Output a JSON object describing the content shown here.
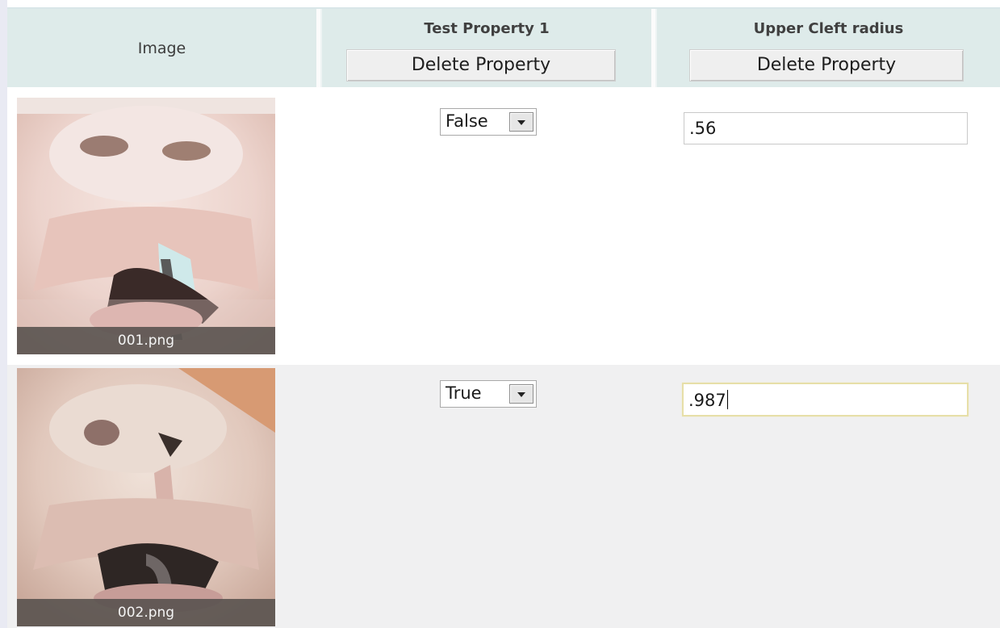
{
  "header": {
    "image_label": "Image",
    "col2_title": "Test Property 1",
    "col2_button": "Delete Property",
    "col3_title": "Upper Cleft radius",
    "col3_button": "Delete Property"
  },
  "rows": [
    {
      "caption": "001.png",
      "select_value": "False",
      "text_value": ".56"
    },
    {
      "caption": "002.png",
      "select_value": "True",
      "text_value": ".987"
    }
  ],
  "colors": {
    "header_bg": "#deebea",
    "row_alt_bg": "#f0f0f1",
    "focus_border": "#e7dfa8"
  },
  "icons": [
    "dropdown-arrow-icon"
  ]
}
